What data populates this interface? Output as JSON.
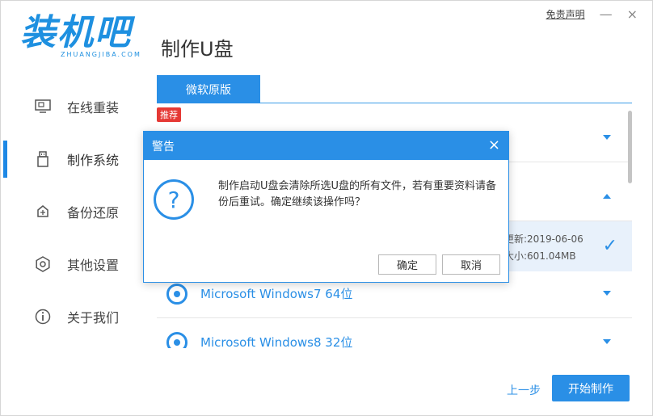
{
  "app": {
    "logo_text": "装机吧",
    "logo_sub": "ZHUANGJIBA.COM",
    "page_title": "制作U盘",
    "disclaimer": "免责声明",
    "minimize": "—",
    "close": "×"
  },
  "sidebar": {
    "items": [
      {
        "label": "在线重装",
        "icon": "monitor-icon"
      },
      {
        "label": "制作系统",
        "icon": "usb-drive-icon",
        "active": true
      },
      {
        "label": "备份还原",
        "icon": "backup-icon"
      },
      {
        "label": "其他设置",
        "icon": "gear-icon"
      },
      {
        "label": "关于我们",
        "icon": "info-icon"
      }
    ]
  },
  "tabs": [
    {
      "label": "微软原版"
    }
  ],
  "badge": "推荐",
  "list": {
    "rows": [
      {
        "name": "Microsoft Windows7 64位"
      },
      {
        "name": "Microsoft Windows8 32位"
      }
    ],
    "detail": {
      "updated": "更新:2019-06-06",
      "size": "大小:601.04MB"
    }
  },
  "footer": {
    "prev_label": "上一步",
    "start_label": "开始制作"
  },
  "dialog": {
    "title": "警告",
    "message": "制作启动U盘会清除所选U盘的所有文件，若有重要资料请备份后重试。确定继续该操作吗？",
    "ok_label": "确定",
    "cancel_label": "取消"
  },
  "colors": {
    "accent": "#2a8fe6",
    "badge": "#e53935"
  }
}
